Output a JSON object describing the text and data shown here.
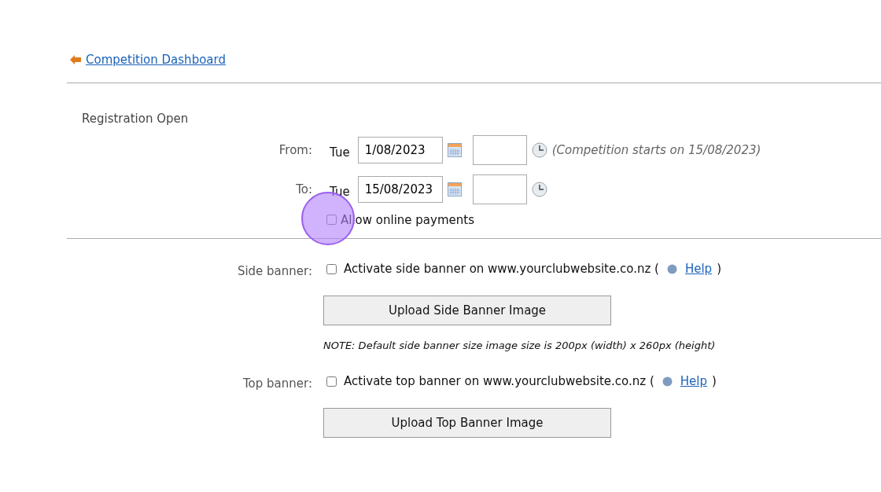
{
  "back_link": {
    "label": "Competition Dashboard"
  },
  "registration": {
    "heading": "Registration Open",
    "rows": [
      {
        "label": "From:",
        "day": "Tue",
        "date": "1/08/2023",
        "time": "",
        "note": "(Competition starts on 15/08/2023)"
      },
      {
        "label": "To:",
        "day": "Tue",
        "date": "15/08/2023",
        "time": ""
      }
    ],
    "online_payments": {
      "label": "Allow online payments",
      "checked": false,
      "click_marker": true
    }
  },
  "banners": [
    {
      "label": "Side banner:",
      "checkbox_label": "Activate side banner on www.yourclubwebsite.co.nz (",
      "checked": false,
      "help": "Help",
      "close": ")",
      "button": "Upload Side Banner Image",
      "note": "NOTE: Default side banner size image size is 200px (width) x 260px (height)"
    },
    {
      "label": "Top banner:",
      "checkbox_label": "Activate top banner on www.yourclubwebsite.co.nz (",
      "checked": false,
      "help": "Help",
      "close": ")",
      "button": "Upload Top Banner Image"
    }
  ]
}
